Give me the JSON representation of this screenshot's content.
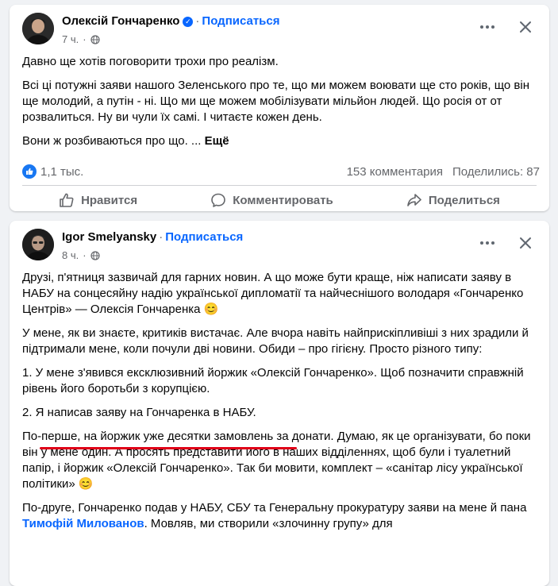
{
  "post1": {
    "author": "Олексій Гончаренко",
    "follow_label": "Подписаться",
    "time": "7 ч.",
    "paragraphs": [
      "Давно ще хотів поговорити трохи про реалізм.",
      "Всі ці потужні заяви нашого Зеленського про те, що ми можем воювати ще сто років, що він ще молодий, а путін - ні. Що ми ще можем мобілізувати мільйон людей. Що росія от от розвалиться. Ну ви чули їх самі. І читаєте кожен день."
    ],
    "last_line": "Вони ж розбиваються про що. ...",
    "see_more": "Ещё",
    "reactions_count": "1,1 тыс.",
    "comments_count": "153 комментария",
    "shares_count": "Поделились: 87",
    "actions": {
      "like": "Нравится",
      "comment": "Комментировать",
      "share": "Поделиться"
    }
  },
  "post2": {
    "author": "Igor Smelyansky",
    "follow_label": "Подписаться",
    "time": "8 ч.",
    "p1": "Друзі, п'ятниця зазвичай для гарних новин. А що може бути краще, ніж написати заяву в НАБУ на сонцесяйну надію української дипломатії та найчеснішого володаря «Гончаренко Центрів» — Олексія Гончаренка 😊",
    "p2": "У мене, як ви знаєте, критиків вистачає. Але вчора навіть найприскіпливіші з них зрадили й підтримали мене, коли почули дві новини. Обиди – про гігієну. Просто різного типу:",
    "p3": "1. У мене з'явився ексклюзивний йоржик «Олексій Гончаренко». Щоб позначити справжній рівень його боротьби з корупцією.",
    "p4": "2. Я написав заяву на Гончаренка в НАБУ.",
    "p5": "По-перше, на йоржик уже десятки замовлень за донати. Думаю, як це організувати, бо поки він у мене один. А просять представити його в наших відділеннях, щоб були і туалетний папір, і йоржик «Олексій Гончаренко». Так би мовити, комплект – «санітар лісу української політики» 😊",
    "p6_start": "По-друге, Гончаренко подав у НАБУ, СБУ та Генеральну прокуратуру заяви на мене й пана ",
    "p6_mention": "Тимофій Милованов",
    "p6_end": ". Мовляв, ми створили «злочинну групу» для"
  },
  "colors": {
    "accent": "#0866ff",
    "highlight_underline": "#e00018",
    "secondary_text": "#65676b"
  }
}
